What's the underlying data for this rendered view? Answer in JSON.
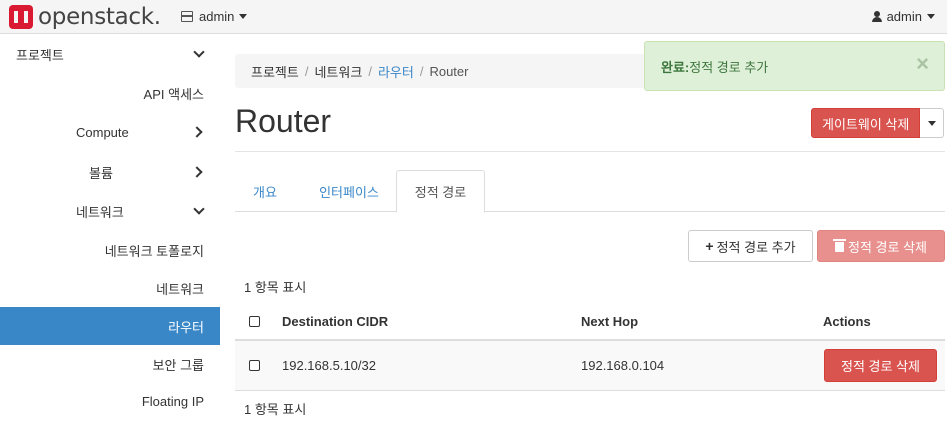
{
  "navbar": {
    "logo_text": "openstack.",
    "project_label": "admin",
    "user_label": "admin"
  },
  "sidebar": {
    "items": [
      {
        "label": "프로젝트",
        "chevron": "chevron-down-icon"
      },
      {
        "label": "API 액세스"
      },
      {
        "label": "Compute",
        "chevron": "chevron-right-icon"
      },
      {
        "label": "볼륨",
        "chevron": "chevron-right-icon"
      },
      {
        "label": "네트워크",
        "chevron": "chevron-down-icon"
      },
      {
        "label": "네트워크 토폴로지"
      },
      {
        "label": "네트워크"
      },
      {
        "label": "라우터",
        "active": true
      },
      {
        "label": "보안 그룹"
      },
      {
        "label": "Floating IP"
      }
    ]
  },
  "breadcrumb": {
    "items": [
      "프로젝트",
      "네트워크",
      "라우터",
      "Router"
    ]
  },
  "alert": {
    "title": "완료:",
    "message": "정적 경로 추가",
    "close": "×"
  },
  "page": {
    "title": "Router",
    "delete_gateway_label": "게이트웨이 삭제"
  },
  "tabs": [
    {
      "label": "개요"
    },
    {
      "label": "인터페이스"
    },
    {
      "label": "정적 경로",
      "active": true
    }
  ],
  "actions": {
    "add_label": "정적 경로 추가",
    "delete_label": "정적 경로 삭제"
  },
  "table": {
    "count_top": "1 항목 표시",
    "count_bottom": "1 항목 표시",
    "headers": [
      "Destination CIDR",
      "Next Hop",
      "Actions"
    ],
    "rows": [
      {
        "destination": "192.168.5.10/32",
        "next_hop": "192.168.0.104",
        "action_label": "정적 경로 삭제"
      }
    ]
  },
  "colors": {
    "accent": "#3a87c8",
    "danger": "#d9534f",
    "success_bg": "#dff0d8",
    "brand_red": "#da1a32"
  }
}
